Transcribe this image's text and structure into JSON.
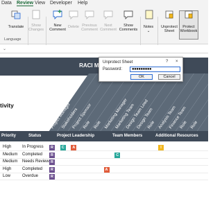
{
  "tabs": [
    "Data",
    "Review",
    "View",
    "Developer",
    "Help"
  ],
  "ribbon": {
    "proofing_label": "Translate",
    "proofing_group": "Language",
    "show_changes": "Show Changes",
    "new_comment": "New Comment",
    "delete": "Delete",
    "previous_comment": "Previous Comment",
    "next_comment": "Next Comment",
    "show_comments": "Show Comments",
    "notes": "Notes",
    "unprotect_sheet": "Unprotect Sheet",
    "protect_workbook": "Protect Workbook"
  },
  "sheet": {
    "title": "RACI MATRIX",
    "subtitle": "tivity",
    "rotated_labels": [
      "Project Manager",
      "Stakeholders",
      "Project Sponsor",
      "Role",
      "Role",
      "Marketing Manager",
      "Marketing Team",
      "Design Team Lead",
      "Design Team",
      "Role",
      "Analysis Team",
      "Finance Team",
      "Role",
      "Role"
    ],
    "headers": {
      "priority": "Priority",
      "status": "Status",
      "group1": "Project Leadership",
      "group2": "Team Members",
      "group3": "Additional Resources"
    },
    "rows": [
      {
        "priority": "High",
        "status": "In Progress",
        "chips": [
          "R",
          "C",
          "A",
          "",
          "",
          "",
          "",
          "",
          "",
          "",
          "I",
          "",
          "",
          ""
        ]
      },
      {
        "priority": "Medium",
        "status": "Completed",
        "chips": [
          "R",
          "",
          "",
          "",
          "",
          "",
          "C",
          "",
          "",
          "",
          "",
          "",
          "",
          ""
        ]
      },
      {
        "priority": "Medium",
        "status": "Needs Review",
        "chips": [
          "R",
          "",
          "",
          "",
          "",
          "",
          "",
          "",
          "",
          "",
          "",
          "",
          "",
          ""
        ]
      },
      {
        "priority": "High",
        "status": "Completed",
        "chips": [
          "R",
          "",
          "",
          "",
          "",
          "A",
          "",
          "",
          "",
          "",
          "",
          "",
          "",
          ""
        ]
      },
      {
        "priority": "Low",
        "status": "Overdue",
        "chips": [
          "R",
          "",
          "",
          "",
          "",
          "",
          "",
          "",
          "",
          "",
          "",
          "",
          "",
          ""
        ]
      }
    ]
  },
  "dialog": {
    "title": "Unprotect Sheet",
    "help": "?",
    "close": "×",
    "password_label": "Password:",
    "password_value": "●●●●●●●●●",
    "ok": "OK",
    "cancel": "Cancel"
  },
  "colors": {
    "R": "#6b4f8e",
    "A": "#e15c3a",
    "C": "#27a79a",
    "I": "#f2b71e"
  }
}
